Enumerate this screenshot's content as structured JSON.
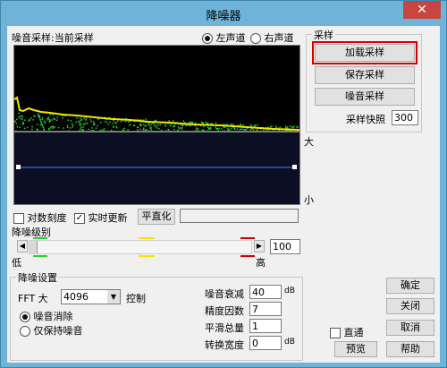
{
  "window": {
    "title": "降噪器",
    "close_glyph": "✕"
  },
  "sample": {
    "label": "噪音采样:当前采样"
  },
  "channel": {
    "left_label": "左声道",
    "right_label": "右声道",
    "selected": "left"
  },
  "axis": {
    "high_label": "大",
    "low_label": "小"
  },
  "options": {
    "log_scale_label": "对数刻度",
    "log_scale_checked": false,
    "realtime_label": "实时更新",
    "realtime_checked": true,
    "flatten_label": "平直化"
  },
  "level": {
    "label": "降噪级别",
    "low_label": "低",
    "high_label": "高",
    "value": "100",
    "fraction": 0
  },
  "sampling": {
    "title": "采样",
    "load_label": "加载采样",
    "save_label": "保存采样",
    "noise_label": "噪音采样",
    "snapshot_label": "采样快照",
    "snapshot_value": "300"
  },
  "settings": {
    "title": "降噪设置",
    "fft_label": "FFT 大",
    "fft_value": "4096",
    "control_label": "控制",
    "remove_label": "噪音消除",
    "keep_label": "仅保持噪音",
    "mode": "remove",
    "params": [
      {
        "label": "噪音衰减",
        "value": "40",
        "unit": "dB"
      },
      {
        "label": "精度因数",
        "value": "7",
        "unit": ""
      },
      {
        "label": "平滑总量",
        "value": "1",
        "unit": ""
      },
      {
        "label": "转换宽度",
        "value": "0",
        "unit": "dB"
      }
    ]
  },
  "actions": {
    "ok_label": "确定",
    "close_label": "关闭",
    "cancel_label": "取消",
    "help_label": "帮助",
    "preview_label": "预览",
    "bypass_label": "直通",
    "bypass_checked": false
  },
  "colors": {
    "title_bar": "#6fb3d8",
    "close": "#c7463f",
    "spectrum_line": "#f2e600",
    "spectrum_dots": "#2ecc2e",
    "curve_line": "#3f7fff",
    "highlight": "#d40000"
  }
}
